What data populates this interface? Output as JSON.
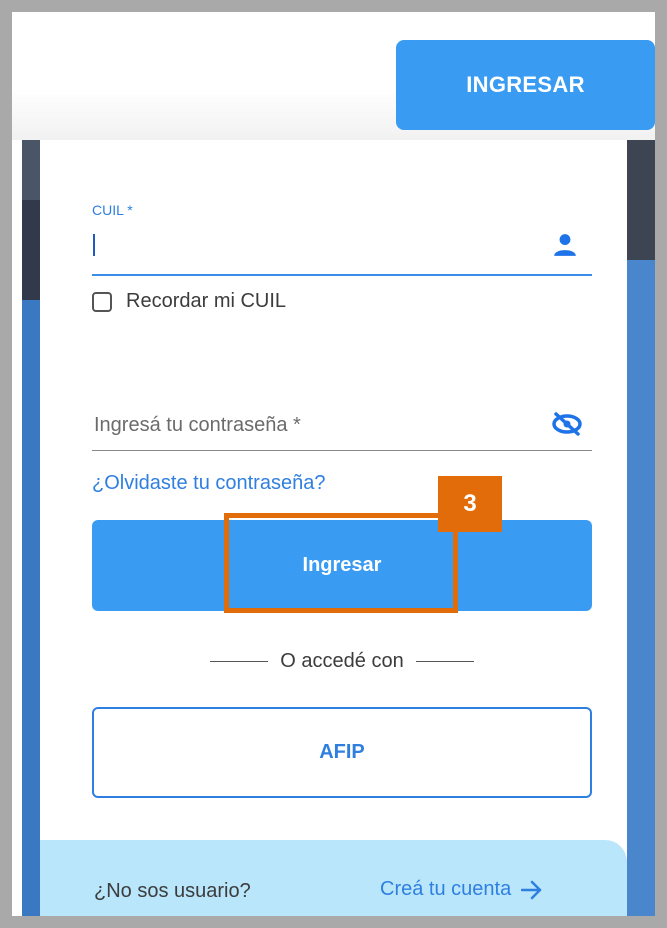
{
  "header": {
    "login_button": "INGRESAR"
  },
  "form": {
    "cuil_label": "CUIL *",
    "cuil_value": "",
    "remember_label": "Recordar mi CUIL",
    "remember_checked": false,
    "password_placeholder": "Ingresá tu contraseña *",
    "forgot_link": "¿Olvidaste tu contraseña?",
    "submit_button": "Ingresar"
  },
  "annotation": {
    "step_number": "3",
    "color": "#e36c0a"
  },
  "alt_login": {
    "divider_text": "O accedé con",
    "afip_button": "AFIP"
  },
  "footer": {
    "no_user_text": "¿No sos usuario?",
    "create_account_link": "Creá tu cuenta"
  },
  "icons": {
    "cuil_field": "user-icon",
    "password_field": "eye-off-icon",
    "create_account": "arrow-right-icon"
  },
  "colors": {
    "primary": "#3a9bf2",
    "link": "#2f7fe0",
    "footer_bg": "#b9e6fb"
  }
}
